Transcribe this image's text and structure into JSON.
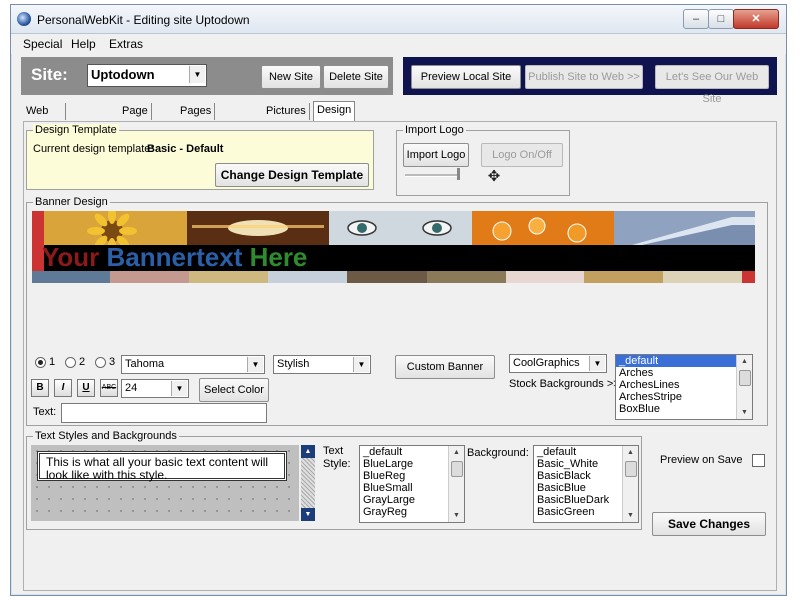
{
  "window": {
    "title": "PersonalWebKit - Editing site Uptodown",
    "controls": {
      "minimize": "–",
      "maximize": "□",
      "close": "✕"
    }
  },
  "menu": [
    "Special",
    "Help",
    "Extras"
  ],
  "site": {
    "label": "Site:",
    "selected": "Uptodown",
    "new_site": "New Site",
    "delete_site": "Delete Site"
  },
  "nav": {
    "preview_local": "Preview Local Site",
    "publish": "Publish Site to Web >>",
    "see_web": "Let's See Our Web Site"
  },
  "tabs": [
    {
      "label": "Web Publish (FTP)"
    },
    {
      "label": "Page Edit"
    },
    {
      "label": "Pages and Links"
    },
    {
      "label": "Pictures"
    },
    {
      "label": "Design"
    }
  ],
  "design_template": {
    "title": "Design Template",
    "current_label": "Current design template:",
    "current_value": "Basic - Default",
    "change_button": "Change Design Template"
  },
  "import_logo": {
    "title": "Import Logo",
    "import_button": "Import Logo",
    "toggle_button": "Logo On/Off"
  },
  "banner": {
    "title": "Banner Design",
    "text_parts": [
      "Your ",
      "Bannertext ",
      "Here"
    ],
    "colors": {
      "part1": "#8b1a1a",
      "part2": "#2b5fa8",
      "part3": "#2e8b2e",
      "strip": [
        "#5f7a96",
        "#c49a90",
        "#cdb880",
        "#c6d0da",
        "#6c5a46",
        "#8a7a5a",
        "#e8d6d0",
        "#c2a060",
        "#dcd2b8",
        "#cc3333"
      ]
    }
  },
  "banner_controls": {
    "radios": [
      "1",
      "2",
      "3"
    ],
    "font": "Tahoma",
    "style": "Stylish",
    "custom_banner": "Custom Banner",
    "size": "24",
    "select_color": "Select Color",
    "text_label": "Text:",
    "text_value": "",
    "bold": "B",
    "italic": "I",
    "underline": "U",
    "abc": "ABC",
    "stock_select": "CoolGraphics",
    "stock_label": "Stock Backgrounds >>",
    "stock_list": [
      "_default",
      "Arches",
      "ArchesLines",
      "ArchesStripe",
      "BoxBlue"
    ]
  },
  "text_styles": {
    "title": "Text Styles and Backgrounds",
    "preview_text": "This is what all your basic text content will look like with this style.",
    "text_style_label": "Text Style:",
    "text_styles_list": [
      "_default",
      "BlueLarge",
      "BlueReg",
      "BlueSmall",
      "GrayLarge",
      "GrayReg"
    ],
    "background_label": "Background:",
    "backgrounds_list": [
      "_default",
      "Basic_White",
      "BasicBlack",
      "BasicBlue",
      "BasicBlueDark",
      "BasicGreen"
    ]
  },
  "preview_on_save": "Preview on Save",
  "save_changes": "Save Changes"
}
